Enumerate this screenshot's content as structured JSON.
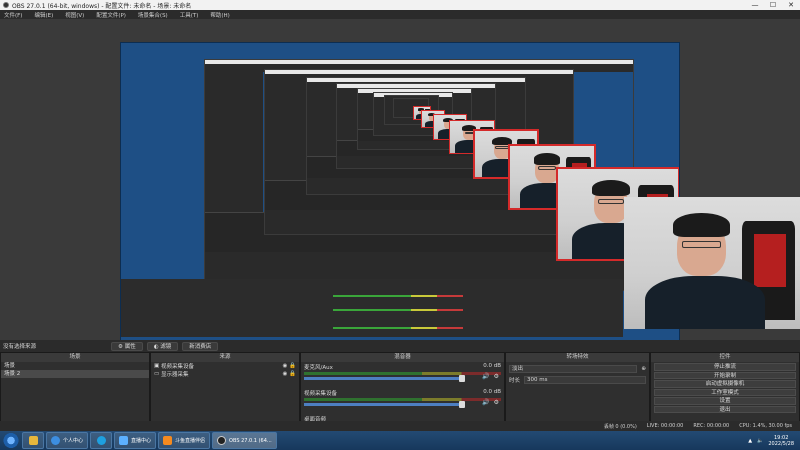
{
  "window": {
    "title": "OBS 27.0.1 (64-bit, windows) - 配置文件: 未命名 - 场景: 未命名",
    "controls": [
      "—",
      "☐",
      "✕"
    ]
  },
  "menu": [
    "文件(F)",
    "编辑(E)",
    "视图(V)",
    "配置文件(P)",
    "场景集合(S)",
    "工具(T)",
    "帮助(H)"
  ],
  "controls_row": {
    "no_source": "没有选择来源",
    "properties": "属性",
    "filters": "滤镜",
    "noise": "新消费店"
  },
  "scenes": {
    "title": "场景",
    "items": [
      {
        "label": "场景",
        "selected": false
      },
      {
        "label": "场景 2",
        "selected": true
      }
    ],
    "tools": [
      "+",
      "−",
      "∧",
      "∨"
    ]
  },
  "sources": {
    "title": "来源",
    "items": [
      {
        "label": "视频采集设备",
        "icon": "camera-icon"
      },
      {
        "label": "显示器采集",
        "icon": "monitor-icon"
      }
    ],
    "tools": [
      "+",
      "−",
      "⚙",
      "∧",
      "∨"
    ]
  },
  "mixer": {
    "title": "混音器",
    "tracks": [
      {
        "name": "桌面音频",
        "db": "0.0 dB"
      },
      {
        "name": "视频采集设备",
        "db": "0.0 dB"
      },
      {
        "name": "麦克风/Aux",
        "db": "0.0 dB"
      }
    ]
  },
  "transitions": {
    "title": "转场特效",
    "selected": "淡出",
    "duration_label": "时长",
    "duration": "300 ms"
  },
  "controls": {
    "title": "控件",
    "buttons": [
      "停止推流",
      "开始录制",
      "启动虚拟摄像机",
      "工作室模式",
      "设置",
      "退出"
    ]
  },
  "status": {
    "dropped": "丢帧 0 (0.0%)",
    "live": "LIVE: 00:00:00",
    "rec": "REC: 00:00:00",
    "cpu": "CPU: 1.4%, 30.00 fps"
  },
  "taskbar": {
    "apps": [
      {
        "label": "",
        "name": "explorer"
      },
      {
        "label": "个人中心",
        "name": "ie"
      },
      {
        "label": "",
        "name": "edge"
      },
      {
        "label": "直播中心",
        "name": "live"
      },
      {
        "label": "斗鱼直播伴侣",
        "name": "douyu"
      },
      {
        "label": "OBS 27.0.1 (64...",
        "name": "obs"
      }
    ],
    "time": "19:02",
    "date": "2022/5/28"
  },
  "colors": {
    "accent": "#4d7fc1",
    "webcam_border": "#d42a2a"
  }
}
